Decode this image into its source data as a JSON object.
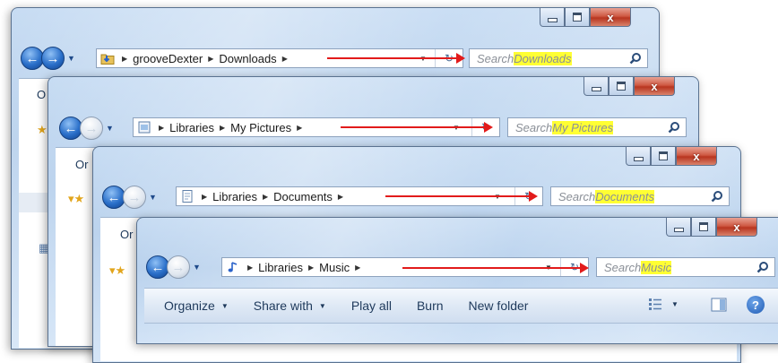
{
  "windows": [
    {
      "id": "downloads",
      "path": [
        "grooveDexter",
        "Downloads"
      ],
      "search_prefix": "Search ",
      "search_term": "Downloads",
      "folder_icon": "downloads-folder-icon",
      "forward_enabled": true,
      "cmd_fragment": "O"
    },
    {
      "id": "pictures",
      "path": [
        "Libraries",
        "My Pictures"
      ],
      "search_prefix": "Search ",
      "search_term": "My Pictures",
      "folder_icon": "pictures-library-icon",
      "forward_enabled": false,
      "cmd_fragment": "Or"
    },
    {
      "id": "documents",
      "path": [
        "Libraries",
        "Documents"
      ],
      "search_prefix": "Search ",
      "search_term": "Documents",
      "folder_icon": "documents-library-icon",
      "forward_enabled": false,
      "cmd_fragment": "Or"
    },
    {
      "id": "music",
      "path": [
        "Libraries",
        "Music"
      ],
      "search_prefix": "Search ",
      "search_term": "Music",
      "folder_icon": "music-library-icon",
      "forward_enabled": false
    }
  ],
  "music_toolbar": {
    "organize": "Organize",
    "share_with": "Share with",
    "play_all": "Play all",
    "burn": "Burn",
    "new_folder": "New folder"
  },
  "colors": {
    "annotation_arrow": "#e21b1b",
    "search_highlight": "#ffff33",
    "close_button": "#c8452e",
    "glass_frame": "#bcd3ee"
  }
}
